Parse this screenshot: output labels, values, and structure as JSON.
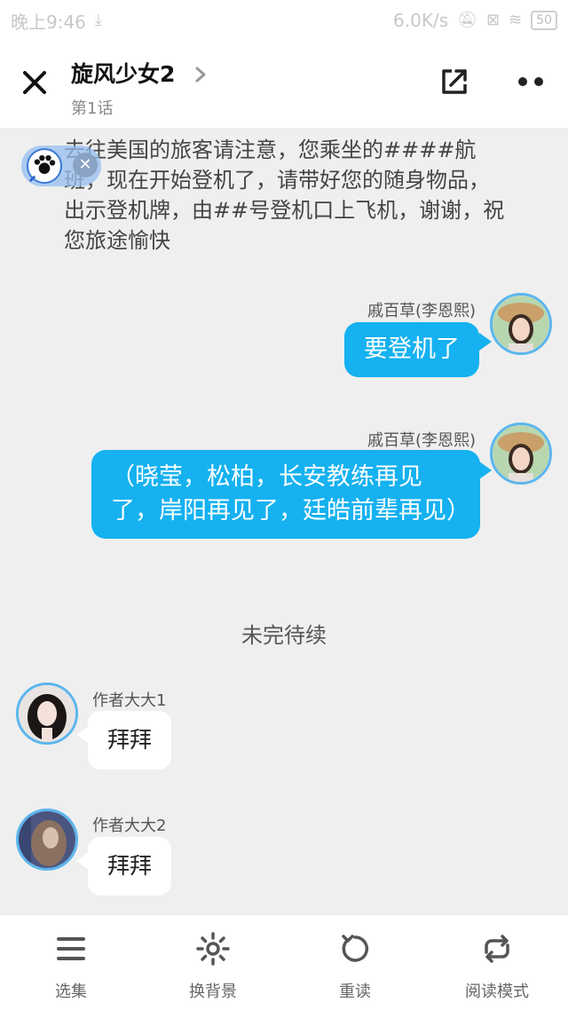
{
  "status_bar": {
    "time": "晚上9:46",
    "speed": "6.0K/s",
    "battery": "50"
  },
  "header": {
    "title": "旋风少女2",
    "subtitle": "第1话"
  },
  "narration": "去往美国的旅客请注意，您乘坐的####航班，现在开始登机了，请带好您的随身物品，出示登机牌，由##号登机口上飞机，谢谢，祝您旅途愉快",
  "messages": [
    {
      "name": "戚百草(李恩熙)",
      "text": "要登机了"
    },
    {
      "name": "戚百草(李恩熙)",
      "text": "（晓莹，松柏，长安教练再见了，岸阳再见了，廷皓前辈再见）"
    },
    {
      "name": "作者大大1",
      "text": "拜拜"
    },
    {
      "name": "作者大大2",
      "text": "拜拜"
    }
  ],
  "to_be_continued": "未完待续",
  "bottom_tabs": [
    {
      "label": "选集",
      "icon": "menu-icon"
    },
    {
      "label": "换背景",
      "icon": "sun-icon"
    },
    {
      "label": "重读",
      "icon": "refresh-icon"
    },
    {
      "label": "阅读模式",
      "icon": "loop-icon"
    }
  ],
  "colors": {
    "accent": "#15b1f0",
    "background": "#efefef"
  }
}
